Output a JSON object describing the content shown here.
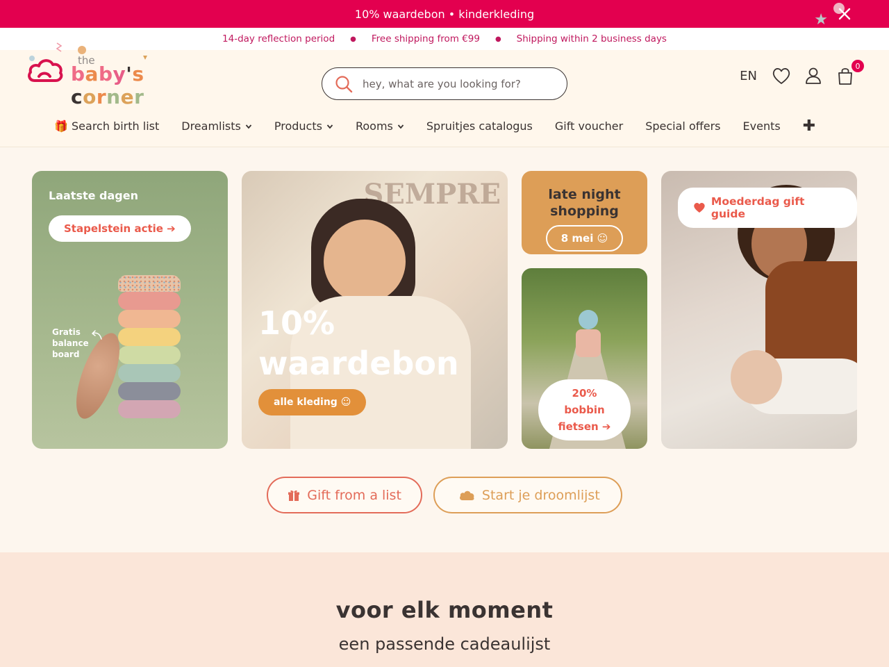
{
  "promo": {
    "text": "10% waardebon • kinderkleding"
  },
  "usp": [
    "14-day reflection period",
    "Free shipping from €99",
    "Shipping within 2 business days"
  ],
  "logo": {
    "the": "the",
    "letters": [
      {
        "ch": "b",
        "color": "#ef6b87"
      },
      {
        "ch": "a",
        "color": "#ec8a4c"
      },
      {
        "ch": "b",
        "color": "#ef6b87"
      },
      {
        "ch": "y",
        "color": "#e85d88"
      },
      {
        "ch": "'",
        "color": "#3a3332"
      },
      {
        "ch": "s",
        "color": "#ec8a4c"
      },
      {
        "ch": " ",
        "color": "#3a3332"
      },
      {
        "ch": "c",
        "color": "#3a3332"
      },
      {
        "ch": "o",
        "color": "#dca25a"
      },
      {
        "ch": "r",
        "color": "#ec8a4c"
      },
      {
        "ch": "n",
        "color": "#a2b98a"
      },
      {
        "ch": "e",
        "color": "#dca25a"
      },
      {
        "ch": "r",
        "color": "#a2b98a"
      }
    ]
  },
  "search": {
    "placeholder": "hey, what are you looking for?"
  },
  "utils": {
    "lang": "EN",
    "cart_count": "0"
  },
  "nav": {
    "items": [
      {
        "label": "🎁 Search birth list",
        "dropdown": false
      },
      {
        "label": "Dreamlists",
        "dropdown": true
      },
      {
        "label": "Products",
        "dropdown": true
      },
      {
        "label": "Rooms",
        "dropdown": true
      },
      {
        "label": "Spruitjes catalogus",
        "dropdown": false
      },
      {
        "label": "Gift voucher",
        "dropdown": false
      },
      {
        "label": "Special offers",
        "dropdown": false
      },
      {
        "label": "Events",
        "dropdown": false
      }
    ],
    "more": "✚"
  },
  "hero": {
    "card1": {
      "kicker": "Laatste dagen",
      "button": "Stapelstein actie ➔",
      "note": [
        "Gratis",
        "balance",
        "board"
      ]
    },
    "card2": {
      "title_line1": "10%",
      "title_line2": "waardebon",
      "button": "alle kleding ☺"
    },
    "card3": {
      "title_line1": "late night",
      "title_line2": "shopping",
      "button": "8 mei ☺"
    },
    "card4": {
      "line1": "20%",
      "line2": "bobbin",
      "line3": "fietsen ➔"
    },
    "card5": {
      "button": "Moederdag gift guide"
    }
  },
  "ctas": {
    "gift": "Gift from a list",
    "dream": "Start je droomlijst"
  },
  "moment": {
    "title": "voor elk moment",
    "subtitle": "een passende cadeaulijst"
  },
  "colors": {
    "brand_pink": "#e3004f",
    "coral": "#e36b59",
    "ochre": "#dd9e57",
    "sage": "#8fa67a"
  }
}
